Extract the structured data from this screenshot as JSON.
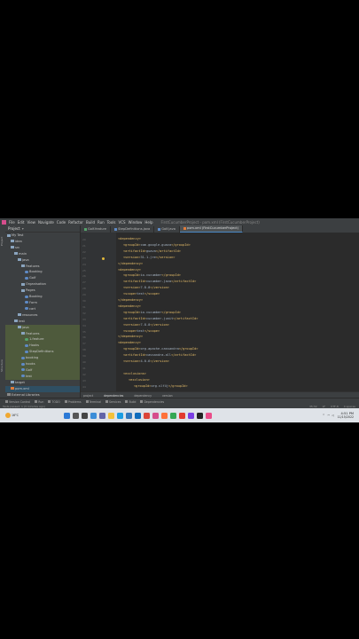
{
  "menu": {
    "items": [
      "File",
      "Edit",
      "View",
      "Navigate",
      "Code",
      "Refactor",
      "Build",
      "Run",
      "Tools",
      "VCS",
      "Window",
      "Help"
    ],
    "path": "FirstCucumberProject - pom.xml (FirstCucumberProject)"
  },
  "side_strip": {
    "top_label": "Project",
    "bottom_label": "Structure"
  },
  "project_panel": {
    "title": "Project",
    "tree": [
      {
        "label": "My Test",
        "icon": "folder",
        "indent": 0,
        "state": ""
      },
      {
        "label": "idea",
        "icon": "folder",
        "indent": 1,
        "state": ""
      },
      {
        "label": "src",
        "icon": "folder",
        "indent": 1,
        "state": ""
      },
      {
        "label": "main",
        "icon": "folder",
        "indent": 2,
        "state": ""
      },
      {
        "label": "java",
        "icon": "folder",
        "indent": 3,
        "state": ""
      },
      {
        "label": "Features",
        "icon": "folder",
        "indent": 4,
        "state": ""
      },
      {
        "label": "Booking",
        "icon": "java",
        "indent": 5,
        "state": ""
      },
      {
        "label": "Golf",
        "icon": "java",
        "indent": 5,
        "state": ""
      },
      {
        "label": "Organisation",
        "icon": "folder",
        "indent": 4,
        "state": ""
      },
      {
        "label": "Pages",
        "icon": "folder",
        "indent": 4,
        "state": ""
      },
      {
        "label": "Booking",
        "icon": "java",
        "indent": 5,
        "state": ""
      },
      {
        "label": "Form",
        "icon": "java",
        "indent": 5,
        "state": ""
      },
      {
        "label": "cart",
        "icon": "java",
        "indent": 5,
        "state": ""
      },
      {
        "label": "resources",
        "icon": "folder",
        "indent": 3,
        "state": ""
      },
      {
        "label": "test",
        "icon": "folder",
        "indent": 2,
        "state": ""
      },
      {
        "label": "java",
        "icon": "folder",
        "indent": 3,
        "state": "hl"
      },
      {
        "label": "Features",
        "icon": "folder",
        "indent": 4,
        "state": "hl"
      },
      {
        "label": "1.feature",
        "icon": "feature",
        "indent": 5,
        "state": "hl"
      },
      {
        "label": "Hooks",
        "icon": "java",
        "indent": 5,
        "state": "hl"
      },
      {
        "label": "StepDefinitions",
        "icon": "java",
        "indent": 5,
        "state": "hl"
      },
      {
        "label": "booking",
        "icon": "java",
        "indent": 4,
        "state": "hl"
      },
      {
        "label": "hooks",
        "icon": "java",
        "indent": 4,
        "state": "hl"
      },
      {
        "label": "Golf",
        "icon": "java",
        "indent": 4,
        "state": "hl"
      },
      {
        "label": "test",
        "icon": "java",
        "indent": 4,
        "state": "hl"
      },
      {
        "label": "target",
        "icon": "folder",
        "indent": 1,
        "state": ""
      },
      {
        "label": "pom.xml",
        "icon": "xml",
        "indent": 1,
        "state": "sel"
      },
      {
        "label": "External Libraries",
        "icon": "lib",
        "indent": 0,
        "state": ""
      },
      {
        "label": "Scratches and Consoles",
        "icon": "lib",
        "indent": 0,
        "state": ""
      }
    ]
  },
  "tabs": [
    {
      "label": "Golf.feature",
      "active": false,
      "color": "#55a36b"
    },
    {
      "label": "StepDefinitions.java",
      "active": false,
      "color": "#5e8ac5"
    },
    {
      "label": "Golf.java",
      "active": false,
      "color": "#5e8ac5"
    },
    {
      "label": "pom.xml (FirstCucumberProject)",
      "active": true,
      "color": "#e07b39"
    }
  ],
  "gutter": {
    "lines": [
      "20",
      "21",
      "22",
      "23",
      "24",
      "25",
      "26",
      "27",
      "28",
      "29",
      "30",
      "31",
      "32",
      "33",
      "34",
      "35",
      "36",
      "37",
      "38",
      "39",
      "40",
      "41",
      "42",
      "43",
      "44",
      "45"
    ],
    "bulb_line": 3
  },
  "code_lines": [
    {
      "indent": 0,
      "text": "<dependency>"
    },
    {
      "indent": 1,
      "text": "<groupId>com.google.guava</groupId>"
    },
    {
      "indent": 1,
      "text": "<artifactId>guava</artifactId>"
    },
    {
      "indent": 1,
      "text": "<version>31.1-jre</version>"
    },
    {
      "indent": 0,
      "text": "</dependency>"
    },
    {
      "indent": 0,
      "text": "<dependency>"
    },
    {
      "indent": 1,
      "text": "<groupId>io.cucumber</groupId>"
    },
    {
      "indent": 1,
      "text": "<artifactId>cucumber-java</artifactId>"
    },
    {
      "indent": 1,
      "text": "<version>7.8.0</version>"
    },
    {
      "indent": 1,
      "text": "<scope>test</scope>"
    },
    {
      "indent": 0,
      "text": "</dependency>"
    },
    {
      "indent": 0,
      "text": "<dependency>"
    },
    {
      "indent": 1,
      "text": "<groupId>io.cucumber</groupId>"
    },
    {
      "indent": 1,
      "text": "<artifactId>cucumber-junit</artifactId>"
    },
    {
      "indent": 1,
      "text": "<version>7.8.0</version>"
    },
    {
      "indent": 1,
      "text": "<scope>test</scope>"
    },
    {
      "indent": 0,
      "text": "</dependency>"
    },
    {
      "indent": 0,
      "text": "<dependency>"
    },
    {
      "indent": 1,
      "text": "<groupId>org.apache.cassandra</groupId>"
    },
    {
      "indent": 1,
      "text": "<artifactId>cassandra-all</artifactId>"
    },
    {
      "indent": 1,
      "text": "<version>4.0.6</version>"
    },
    {
      "indent": 0,
      "text": ""
    },
    {
      "indent": 1,
      "text": "<exclusions>"
    },
    {
      "indent": 2,
      "text": "<exclusion>"
    },
    {
      "indent": 3,
      "text": "<groupId>org.slf4j</groupId>"
    }
  ],
  "editor_tabs": [
    {
      "label": "project",
      "active": false
    },
    {
      "label": "dependencies",
      "active": true
    },
    {
      "label": "dependency",
      "active": false
    },
    {
      "label": "version",
      "active": false
    }
  ],
  "bottom_tools": [
    "Version Control",
    "Run",
    "TODO",
    "Problems",
    "Terminal",
    "Services",
    "Build",
    "Dependencies"
  ],
  "status": {
    "left": "Tests passed: 1 (3 minutes ago)",
    "right": [
      "35:32",
      "LF",
      "UTF-8",
      "4 spaces"
    ]
  },
  "taskbar": {
    "weather_temp": "16°C",
    "icons": [
      {
        "name": "start-icon",
        "color": "#2b79d6"
      },
      {
        "name": "search-icon",
        "color": "#555555"
      },
      {
        "name": "task-view-icon",
        "color": "#444444"
      },
      {
        "name": "widgets-icon",
        "color": "#3c8ed8"
      },
      {
        "name": "chat-icon",
        "color": "#6264a7"
      },
      {
        "name": "explorer-icon",
        "color": "#f3c13a"
      },
      {
        "name": "edge-icon",
        "color": "#1b9de2"
      },
      {
        "name": "store-icon",
        "color": "#3277bc"
      },
      {
        "name": "mail-icon",
        "color": "#0f6cbd"
      },
      {
        "name": "chrome-icon",
        "color": "#db4437"
      },
      {
        "name": "intellij-icon",
        "color": "#d64d8c"
      },
      {
        "name": "firefox-icon",
        "color": "#ff7139"
      },
      {
        "name": "app-icon",
        "color": "#34a853"
      },
      {
        "name": "app-icon",
        "color": "#e33b2e"
      },
      {
        "name": "app-icon",
        "color": "#7b3fe4"
      },
      {
        "name": "app-icon",
        "color": "#222222"
      },
      {
        "name": "app-icon",
        "color": "#ea4c89"
      }
    ],
    "time": "4:51 PM",
    "date": "11/15/2022"
  }
}
